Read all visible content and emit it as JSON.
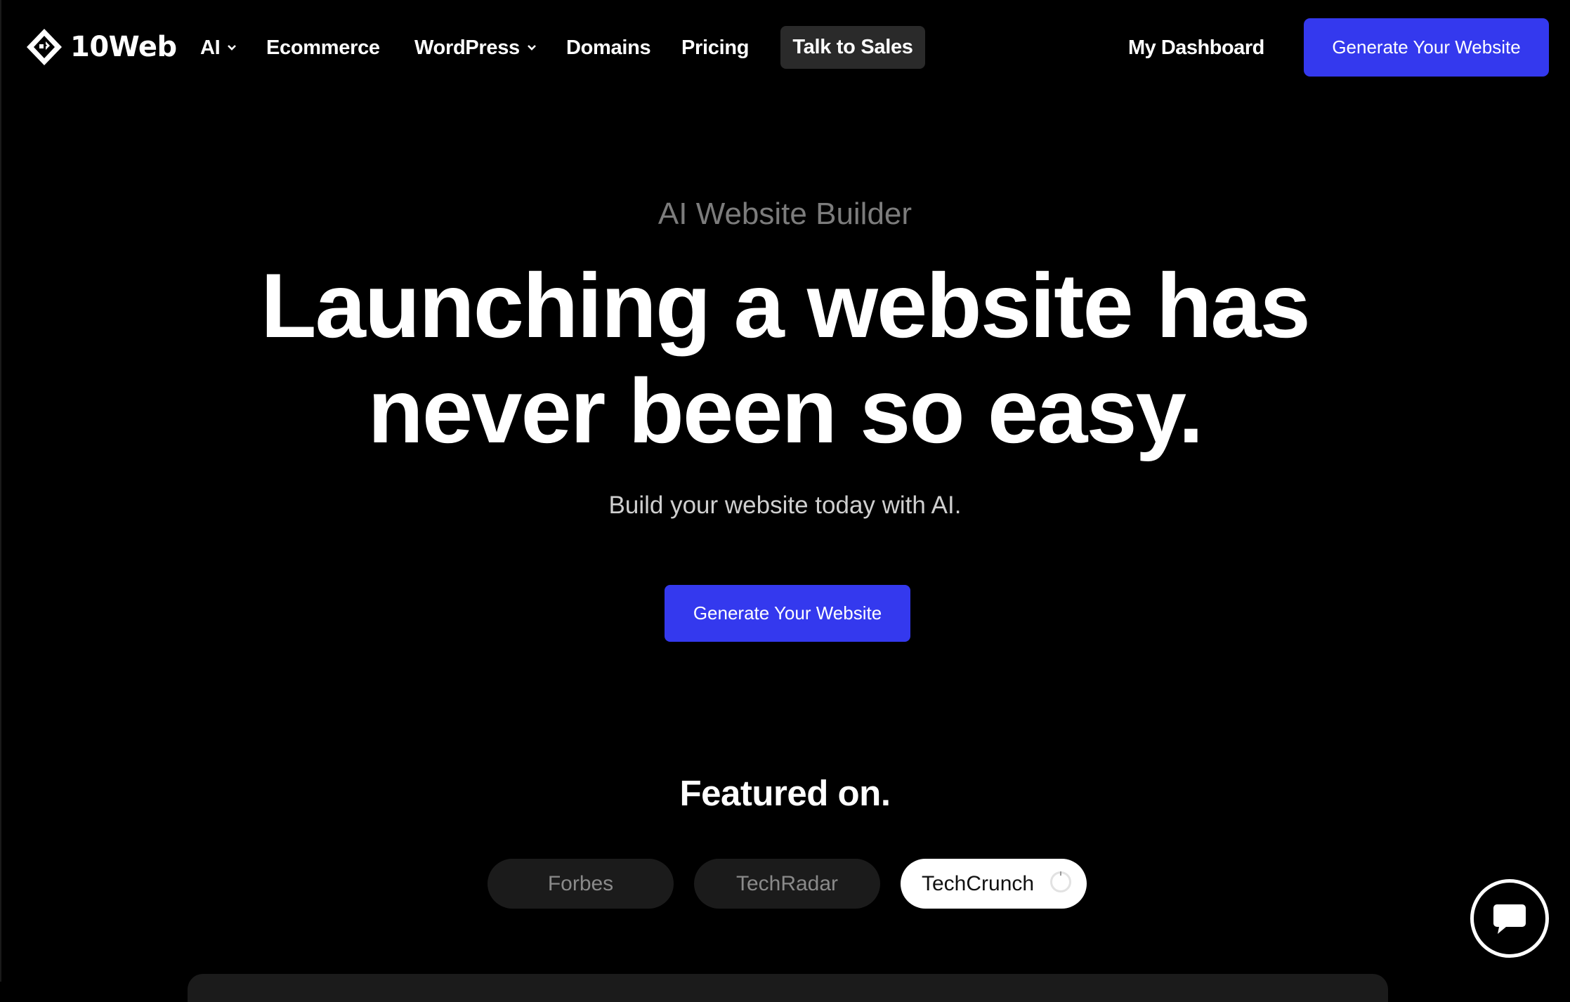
{
  "brand": {
    "name": "10Web",
    "logo_icon": "10web-diamond-logo"
  },
  "nav": {
    "items": [
      {
        "label": "AI",
        "has_dropdown": true
      },
      {
        "label": "Ecommerce",
        "has_dropdown": false
      },
      {
        "label": "WordPress",
        "has_dropdown": true
      },
      {
        "label": "Domains",
        "has_dropdown": false
      },
      {
        "label": "Pricing",
        "has_dropdown": false
      }
    ],
    "talk_to_sales": "Talk to Sales",
    "dashboard": "My Dashboard",
    "cta": "Generate Your Website"
  },
  "hero": {
    "eyebrow": "AI Website Builder",
    "headline_line1": "Launching a website has",
    "headline_line2": "never been so easy.",
    "subtext": "Build your website today with AI.",
    "cta": "Generate Your Website"
  },
  "featured": {
    "title": "Featured on.",
    "tabs": [
      {
        "label": "Forbes",
        "active": false
      },
      {
        "label": "TechRadar",
        "active": false
      },
      {
        "label": "TechCrunch",
        "active": true,
        "loading": true
      }
    ]
  },
  "chat_widget": {
    "icon": "chat-bubble-icon"
  },
  "colors": {
    "background": "#000000",
    "accent": "#3439ee",
    "muted_text": "#7c7c7c",
    "pill_bg": "#1b1b1b"
  }
}
